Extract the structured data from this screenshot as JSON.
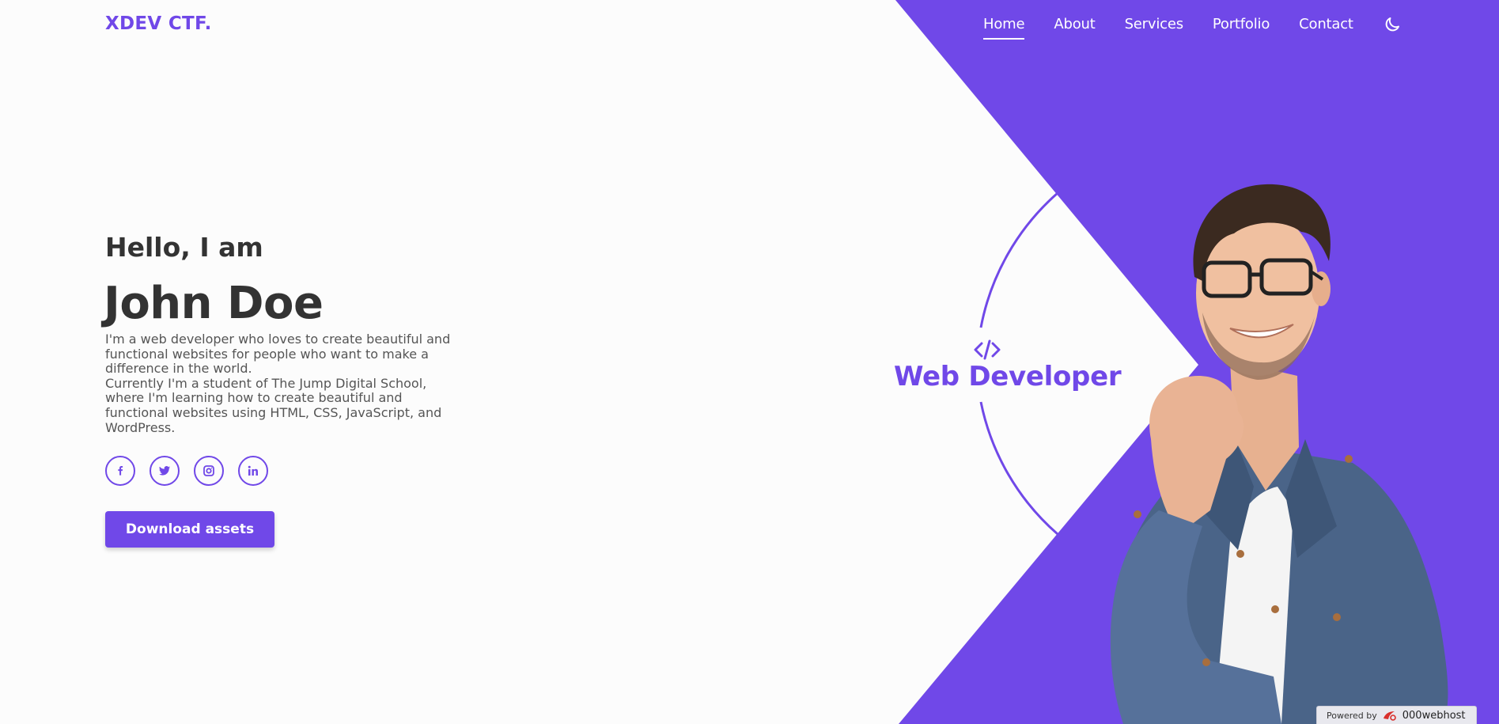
{
  "header": {
    "logo": "XDEV CTF.",
    "nav": [
      {
        "label": "Home",
        "active": true
      },
      {
        "label": "About",
        "active": false
      },
      {
        "label": "Services",
        "active": false
      },
      {
        "label": "Portfolio",
        "active": false
      },
      {
        "label": "Contact",
        "active": false
      }
    ],
    "theme_toggle_icon": "moon-icon"
  },
  "hero": {
    "greeting": "Hello, I am",
    "name": "John Doe",
    "bio_lines": [
      "I'm a web developer who loves to create beautiful and functional websites for people who want to make a difference in the world.",
      "Currently I'm a student of The Jump Digital School, where I'm learning how to create beautiful and functional websites using HTML, CSS, JavaScript, and WordPress."
    ],
    "socials": [
      {
        "icon": "facebook-icon"
      },
      {
        "icon": "twitter-icon"
      },
      {
        "icon": "instagram-icon"
      },
      {
        "icon": "linkedin-icon"
      }
    ],
    "download_label": "Download assets",
    "role_icon": "code-icon",
    "role": "Web Developer"
  },
  "footer_badge": {
    "powered_label": "Powered by",
    "brand": "000webhost"
  },
  "colors": {
    "accent": "#7048e8",
    "text": "#333333",
    "background": "#fcfcfc"
  }
}
